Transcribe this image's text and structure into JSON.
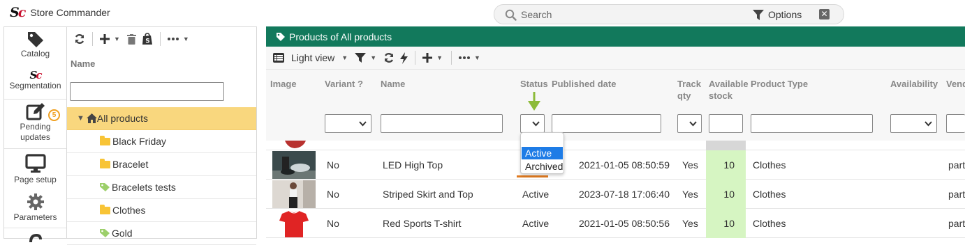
{
  "app": {
    "title": "Store Commander",
    "logo_s": "S",
    "logo_c": "c"
  },
  "search": {
    "placeholder": "Search",
    "options_label": "Options"
  },
  "rail": {
    "items": [
      {
        "label": "Catalog",
        "icon": "tag-icon"
      },
      {
        "label": "Segmentation",
        "icon": "sc-logo-icon"
      },
      {
        "label_line1": "Pending",
        "label_line2": "updates",
        "badge": "5",
        "icon": "edit-icon"
      },
      {
        "label": "Page setup",
        "icon": "monitor-icon"
      },
      {
        "label": "Parameters",
        "icon": "gear-icon"
      }
    ]
  },
  "tree": {
    "column_header": "Name",
    "items": [
      {
        "label": "All products",
        "selected": true,
        "icon": "home-icon"
      },
      {
        "label": "Black Friday",
        "icon": "folder-icon"
      },
      {
        "label": "Bracelet",
        "icon": "folder-icon"
      },
      {
        "label": "Bracelets tests",
        "icon": "tag-icon"
      },
      {
        "label": "Clothes",
        "icon": "folder-icon"
      },
      {
        "label": "Gold",
        "icon": "tag-icon"
      }
    ]
  },
  "products": {
    "header": "Products of All products",
    "view_label": "Light view",
    "columns": {
      "image": "Image",
      "variant": "Variant ?",
      "name": "Name",
      "status": "Status",
      "published": "Published date",
      "track_line1": "Track",
      "track_line2": "qty",
      "stock_line1": "Available",
      "stock_line2": "stock",
      "type": "Product Type",
      "availability": "Availability",
      "vendor": "Vend"
    },
    "status_dropdown": {
      "options": [
        "Active",
        "Archived"
      ],
      "highlighted": "Active"
    },
    "rows": [
      {
        "variant": "No",
        "name": "LED High Top",
        "status": "",
        "published": "2021-01-05 08:50:59",
        "track": "Yes",
        "stock": "10",
        "type": "Clothes",
        "vendor": "part"
      },
      {
        "variant": "No",
        "name": "Striped Skirt and Top",
        "status": "Active",
        "published": "2023-07-18 17:06:40",
        "track": "Yes",
        "stock": "10",
        "type": "Clothes",
        "vendor": "part"
      },
      {
        "variant": "No",
        "name": "Red Sports T-shirt",
        "status": "Active",
        "published": "2021-01-05 08:50:56",
        "track": "Yes",
        "stock": "10",
        "type": "Clothes",
        "vendor": "part"
      }
    ]
  },
  "colors": {
    "brand_green": "#12795c",
    "selected_row": "#f9d77e",
    "stock_bg": "#d6f5c2",
    "dropdown_highlight": "#1e7ce6",
    "arrow_green": "#8dbb3a",
    "logo_red": "#c8102e"
  }
}
